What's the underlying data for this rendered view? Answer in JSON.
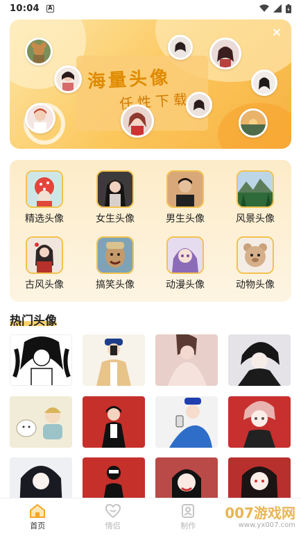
{
  "status": {
    "time": "10:04",
    "a_icon": "A"
  },
  "banner": {
    "title": "海量头像",
    "subtitle": "任性下载",
    "close_label": "×"
  },
  "categories": [
    {
      "label": "精选头像",
      "icon": "strawberry-doll-thumb"
    },
    {
      "label": "女生头像",
      "icon": "girl-portrait-thumb"
    },
    {
      "label": "男生头像",
      "icon": "boy-portrait-thumb"
    },
    {
      "label": "风景头像",
      "icon": "landscape-thumb"
    },
    {
      "label": "古风头像",
      "icon": "ancient-style-thumb"
    },
    {
      "label": "搞笑头像",
      "icon": "funny-face-thumb"
    },
    {
      "label": "动漫头像",
      "icon": "anime-girl-thumb"
    },
    {
      "label": "动物头像",
      "icon": "teddy-bear-thumb"
    }
  ],
  "hot": {
    "title": "热门头像"
  },
  "tabs": [
    {
      "label": "首页",
      "icon": "home-icon",
      "active": true
    },
    {
      "label": "情侣",
      "icon": "heart-icon",
      "active": false
    },
    {
      "label": "制作",
      "icon": "edit-icon",
      "active": false
    }
  ],
  "watermark": {
    "main": "007游戏网",
    "sub": "www.yx007.com"
  },
  "colors": {
    "accent": "#f7b042",
    "tab_active": "#f5a623"
  }
}
